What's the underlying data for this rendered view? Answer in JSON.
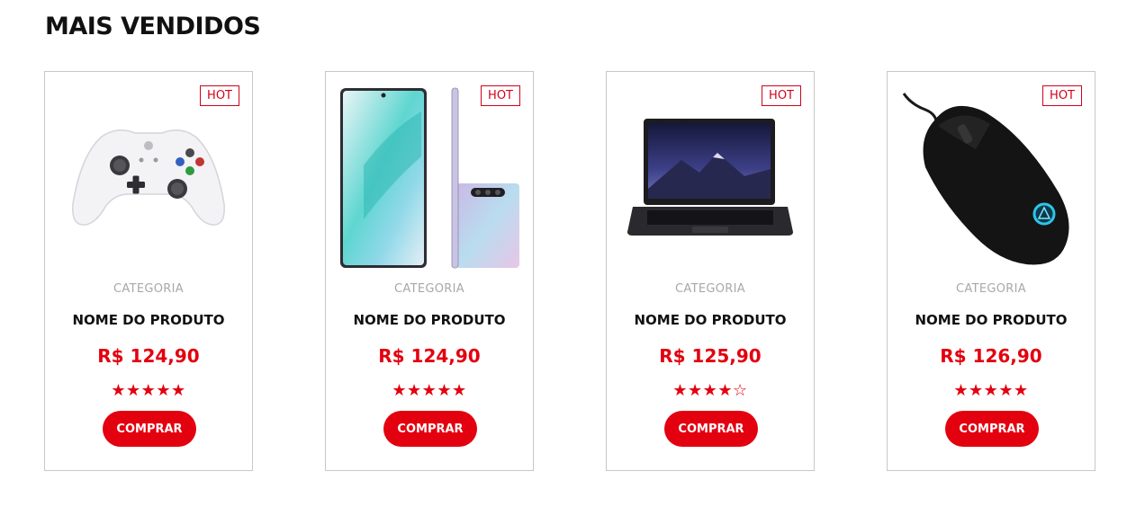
{
  "section": {
    "title": "MAIS VENDIDOS"
  },
  "products": [
    {
      "badge": "HOT",
      "image": "xbox-controller",
      "category": "CATEGORIA",
      "name": "NOME DO PRODUTO",
      "price": "R$ 124,90",
      "rating": 5,
      "rating_max": 5,
      "button": "COMPRAR"
    },
    {
      "badge": "HOT",
      "image": "smartphone",
      "category": "CATEGORIA",
      "name": "NOME DO PRODUTO",
      "price": "R$ 124,90",
      "rating": 5,
      "rating_max": 5,
      "button": "COMPRAR"
    },
    {
      "badge": "HOT",
      "image": "laptop",
      "category": "CATEGORIA",
      "name": "NOME DO PRODUTO",
      "price": "R$ 125,90",
      "rating": 4,
      "rating_max": 5,
      "button": "COMPRAR"
    },
    {
      "badge": "HOT",
      "image": "gaming-mouse",
      "category": "CATEGORIA",
      "name": "NOME DO PRODUTO",
      "price": "R$ 126,90",
      "rating": 5,
      "rating_max": 5,
      "button": "COMPRAR"
    }
  ],
  "colors": {
    "accent": "#e3000f",
    "badge": "#d0021b",
    "border": "#c8c8c8",
    "category": "#a8a8a8"
  }
}
